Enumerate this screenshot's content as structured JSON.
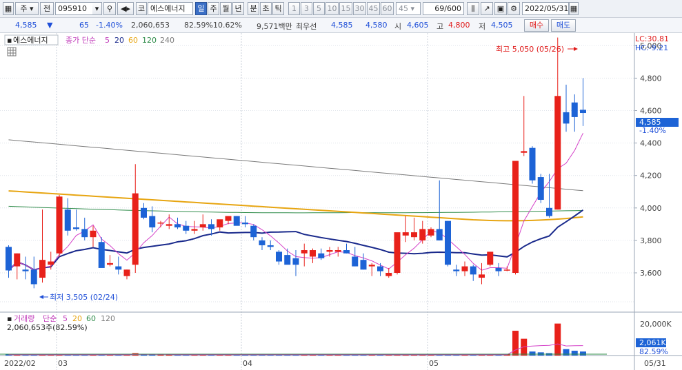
{
  "toolbar": {
    "market": "주",
    "type_btn": "전",
    "code": "095910",
    "name_prefix": "코",
    "name": "에스에너지",
    "periods": [
      "일",
      "주",
      "월",
      "년",
      "분",
      "초",
      "틱"
    ],
    "selected_period": "일",
    "intervals": [
      "1",
      "3",
      "5",
      "10",
      "15",
      "30",
      "45",
      "60"
    ],
    "interval_value": "45",
    "count": "69/600",
    "date": "2022/05/31"
  },
  "quote": {
    "price": "4,585",
    "arrow": "▼",
    "change": "65",
    "change_pct": "-1.40%",
    "volume": "2,060,653",
    "vol_ratio": "82.59%",
    "turnover": "10.62%",
    "amount": "9,571백만",
    "best_label": "최우선",
    "ask": "4,585",
    "bid": "4,580",
    "open_label": "시",
    "open": "4,605",
    "high_label": "고",
    "high": "4,800",
    "low_label": "저",
    "low": "4,505",
    "buy_label": "매수",
    "sell_label": "매도"
  },
  "price_panel": {
    "title": "에스에너지",
    "ma_label": "종가 단순",
    "ma_periods": [
      "5",
      "20",
      "60",
      "120",
      "240"
    ],
    "lc": "LC:30.81",
    "hc": "HC:-9.21",
    "high_note": "최고 5,050 (05/26)",
    "low_note": "최저 3,505 (02/24)",
    "last_price_tag": "4,585",
    "last_pct_tag": "-1.40%"
  },
  "volume_panel": {
    "title": "거래량",
    "ma_label": "단순",
    "ma_periods": [
      "5",
      "20",
      "60",
      "120"
    ],
    "value_text": "2,060,653주(82.59%)",
    "tag_value": "2,061K",
    "tag_pct": "82.59%",
    "axis_top": "20,000K"
  },
  "colors": {
    "up": "#e8211a",
    "down": "#1d63d6",
    "ma5": "#d440c8",
    "ma20": "#1a2a8c",
    "ma60": "#e7a511",
    "ma120": "#2f8c4a",
    "ma240": "#7a7a7a"
  },
  "chart_data": {
    "type": "candlestick",
    "y_ticks": [
      "5,000",
      "4,800",
      "4,600",
      "4,400",
      "4,200",
      "4,000",
      "3,800",
      "3,600"
    ],
    "x_labels": [
      "2022/02",
      "03",
      "04",
      "05",
      "05/31"
    ],
    "candles": [
      [
        3760,
        3770,
        3570,
        3615
      ],
      [
        3640,
        3720,
        3560,
        3720
      ],
      [
        3620,
        3700,
        3560,
        3610
      ],
      [
        3620,
        3700,
        3505,
        3530
      ],
      [
        3570,
        3990,
        3540,
        3680
      ],
      [
        3650,
        3730,
        3620,
        3670
      ],
      [
        3720,
        4080,
        3700,
        4070
      ],
      [
        3990,
        4060,
        3830,
        3860
      ],
      [
        3880,
        3990,
        3860,
        3870
      ],
      [
        3870,
        3940,
        3800,
        3820
      ],
      [
        3820,
        3890,
        3760,
        3860
      ],
      [
        3790,
        3820,
        3640,
        3630
      ],
      [
        3650,
        3710,
        3640,
        3660
      ],
      [
        3640,
        3700,
        3590,
        3620
      ],
      [
        3580,
        3620,
        3560,
        3620
      ],
      [
        3650,
        4270,
        3600,
        4090
      ],
      [
        4000,
        4030,
        3930,
        3940
      ],
      [
        3950,
        4010,
        3850,
        3880
      ],
      [
        3910,
        3920,
        3880,
        3910
      ],
      [
        3890,
        3960,
        3870,
        3900
      ],
      [
        3900,
        3940,
        3870,
        3880
      ],
      [
        3890,
        3920,
        3840,
        3860
      ],
      [
        3860,
        3920,
        3840,
        3870
      ],
      [
        3880,
        3960,
        3860,
        3900
      ],
      [
        3900,
        3930,
        3830,
        3870
      ],
      [
        3880,
        3920,
        3860,
        3930
      ],
      [
        3920,
        3950,
        3900,
        3950
      ],
      [
        3950,
        3950,
        3900,
        3890
      ],
      [
        3910,
        3950,
        3880,
        3900
      ],
      [
        3890,
        3900,
        3800,
        3820
      ],
      [
        3800,
        3820,
        3740,
        3770
      ],
      [
        3770,
        3800,
        3740,
        3760
      ],
      [
        3730,
        3740,
        3650,
        3670
      ],
      [
        3710,
        3750,
        3670,
        3650
      ],
      [
        3690,
        3740,
        3580,
        3650
      ],
      [
        3720,
        3780,
        3640,
        3740
      ],
      [
        3700,
        3750,
        3660,
        3740
      ],
      [
        3720,
        3750,
        3680,
        3690
      ],
      [
        3730,
        3760,
        3700,
        3740
      ],
      [
        3730,
        3760,
        3700,
        3740
      ],
      [
        3740,
        3780,
        3720,
        3720
      ],
      [
        3700,
        3760,
        3640,
        3640
      ],
      [
        3680,
        3720,
        3620,
        3620
      ],
      [
        3640,
        3660,
        3580,
        3650
      ],
      [
        3640,
        3660,
        3580,
        3610
      ],
      [
        3580,
        3630,
        3570,
        3600
      ],
      [
        3600,
        3840,
        3590,
        3850
      ],
      [
        3830,
        3950,
        3790,
        3850
      ],
      [
        3820,
        3940,
        3800,
        3850
      ],
      [
        3800,
        3920,
        3780,
        3870
      ],
      [
        3830,
        3880,
        3820,
        3870
      ],
      [
        3870,
        4170,
        3800,
        3800
      ],
      [
        3920,
        3920,
        3640,
        3650
      ],
      [
        3620,
        3650,
        3580,
        3610
      ],
      [
        3610,
        3670,
        3580,
        3640
      ],
      [
        3640,
        3650,
        3550,
        3590
      ],
      [
        3570,
        3660,
        3530,
        3590
      ],
      [
        3650,
        3730,
        3640,
        3730
      ],
      [
        3630,
        3660,
        3580,
        3610
      ],
      [
        3620,
        3640,
        3610,
        3620
      ],
      [
        3600,
        4280,
        3590,
        4290
      ],
      [
        4340,
        4690,
        4320,
        4350
      ],
      [
        4370,
        4380,
        4150,
        4170
      ],
      [
        4190,
        4210,
        4030,
        4050
      ],
      [
        4000,
        4210,
        3940,
        3950
      ],
      [
        3990,
        5050,
        3990,
        4690
      ],
      [
        4590,
        4760,
        4470,
        4520
      ],
      [
        4650,
        4700,
        4470,
        4560
      ],
      [
        4605,
        4800,
        4505,
        4585
      ]
    ],
    "volume_ratio": [
      0.02,
      0.02,
      0.02,
      0.02,
      0.02,
      0.02,
      0.03,
      0.02,
      0.02,
      0.02,
      0.02,
      0.02,
      0.02,
      0.02,
      0.02,
      0.06,
      0.02,
      0.02,
      0.02,
      0.02,
      0.02,
      0.02,
      0.02,
      0.02,
      0.02,
      0.02,
      0.02,
      0.02,
      0.02,
      0.02,
      0.02,
      0.02,
      0.02,
      0.02,
      0.02,
      0.02,
      0.02,
      0.02,
      0.02,
      0.02,
      0.02,
      0.02,
      0.02,
      0.02,
      0.02,
      0.02,
      0.02,
      0.02,
      0.02,
      0.02,
      0.02,
      0.02,
      0.02,
      0.02,
      0.02,
      0.02,
      0.02,
      0.02,
      0.02,
      0.02,
      0.62,
      0.42,
      0.1,
      0.08,
      0.06,
      0.8,
      0.16,
      0.12,
      0.1
    ]
  }
}
